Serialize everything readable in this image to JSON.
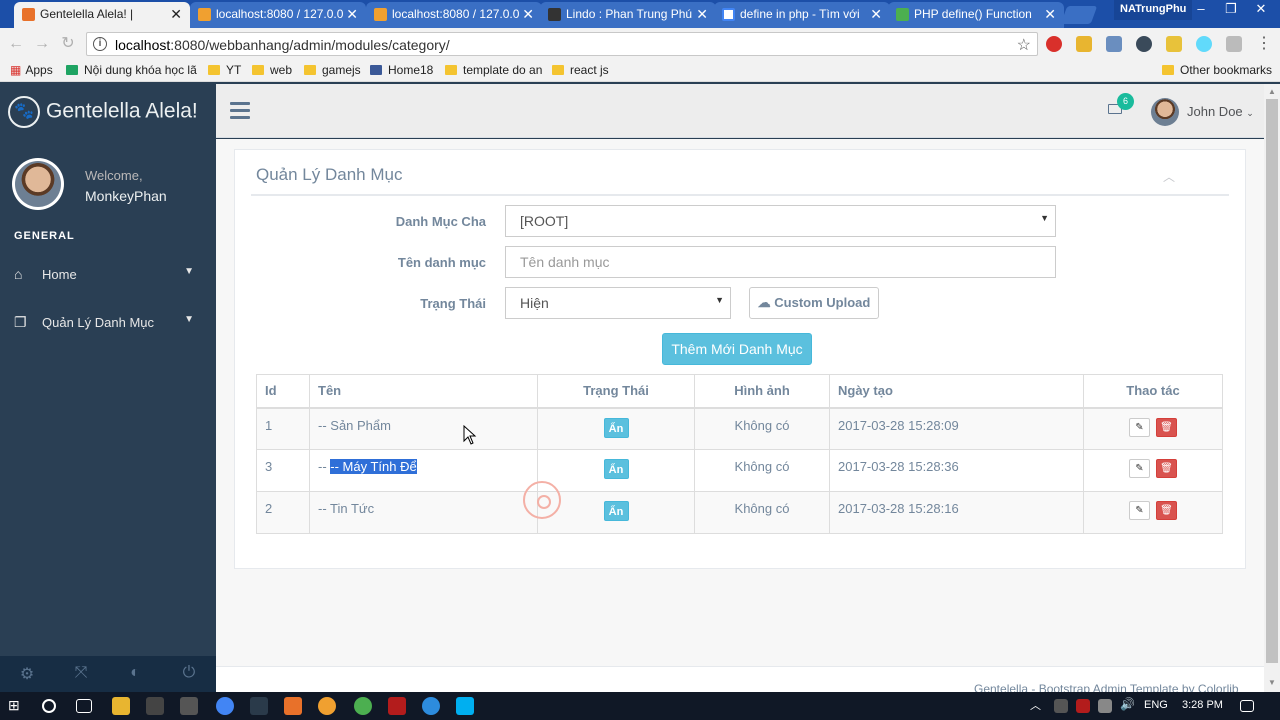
{
  "browser": {
    "tabs": [
      {
        "title": "Gentelella Alela! |",
        "active": true
      },
      {
        "title": "localhost:8080 / 127.0.0",
        "active": false
      },
      {
        "title": "localhost:8080 / 127.0.0",
        "active": false
      },
      {
        "title": "Lindo : Phan Trung Phú",
        "active": false
      },
      {
        "title": "define in php - Tìm với",
        "active": false
      },
      {
        "title": "PHP define() Function",
        "active": false
      }
    ],
    "profile_name": "NATrungPhu",
    "url_host": "localhost",
    "url_rest": ":8080/webbanhang/admin/modules/category/",
    "bookmarks": [
      "Apps",
      "Nội dung khóa học lã",
      "YT",
      "web",
      "gamejs",
      "Home18",
      "template do an",
      "react js"
    ],
    "other_bookmarks": "Other bookmarks"
  },
  "sidebar": {
    "brand": "Gentelella Alela!",
    "welcome": "Welcome,",
    "username": "MonkeyPhan",
    "section": "GENERAL",
    "items": [
      {
        "label": "Home"
      },
      {
        "label": "Quản Lý Danh Mục"
      }
    ]
  },
  "topnav": {
    "mail_count": "6",
    "user": "John Doe"
  },
  "panel": {
    "title": "Quản Lý Danh Mục",
    "form": {
      "parent_label": "Danh Mục Cha",
      "parent_value": "[ROOT]",
      "name_label": "Tên danh mục",
      "name_placeholder": "Tên danh mục",
      "status_label": "Trạng Thái",
      "status_value": "Hiện",
      "upload_label": "Custom Upload",
      "submit_label": "Thêm Mới Danh Mục"
    },
    "table": {
      "headers": [
        "Id",
        "Tên",
        "Trạng Thái",
        "Hình ảnh",
        "Ngày tạo",
        "Thao tác"
      ],
      "rows": [
        {
          "id": "1",
          "name": "-- Sản Phẩm",
          "status": "Ẩn",
          "image": "Không có",
          "created": "2017-03-28 15:28:09"
        },
        {
          "id": "3",
          "name_prefix": "-- ",
          "name": "-- Máy Tính Để",
          "status": "Ẩn",
          "image": "Không có",
          "created": "2017-03-28 15:28:36"
        },
        {
          "id": "2",
          "name": "-- Tin Tức",
          "status": "Ẩn",
          "image": "Không có",
          "created": "2017-03-28 15:28:16"
        }
      ]
    }
  },
  "footer": "Gentelella - Bootstrap Admin Template by Colorlib",
  "taskbar": {
    "lang": "ENG",
    "time": "3:28 PM"
  },
  "colors": {
    "sidebar": "#2A3F54",
    "accent_info": "#5BC0DE",
    "danger": "#D9534F",
    "badge": "#1ABB9C"
  }
}
